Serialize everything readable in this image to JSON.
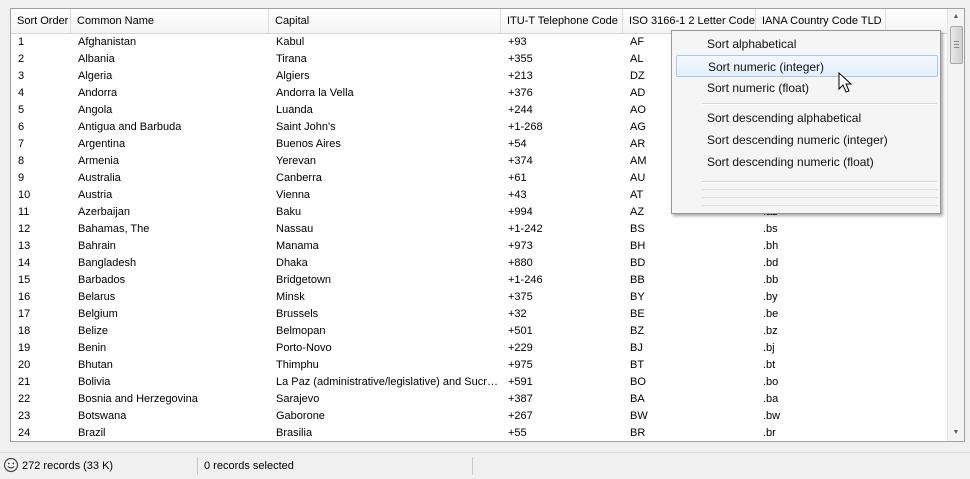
{
  "table": {
    "columns": [
      "Sort Order",
      "Common Name",
      "Capital",
      "ITU-T Telephone Code",
      "ISO 3166-1 2 Letter Code",
      "IANA Country Code TLD"
    ],
    "rows": [
      [
        "1",
        "Afghanistan",
        "Kabul",
        "+93",
        "AF",
        ""
      ],
      [
        "2",
        "Albania",
        "Tirana",
        "+355",
        "AL",
        ""
      ],
      [
        "3",
        "Algeria",
        "Algiers",
        "+213",
        "DZ",
        ""
      ],
      [
        "4",
        "Andorra",
        "Andorra la Vella",
        "+376",
        "AD",
        ""
      ],
      [
        "5",
        "Angola",
        "Luanda",
        "+244",
        "AO",
        ""
      ],
      [
        "6",
        "Antigua and Barbuda",
        "Saint John's",
        "+1-268",
        "AG",
        ""
      ],
      [
        "7",
        "Argentina",
        "Buenos Aires",
        "+54",
        "AR",
        ""
      ],
      [
        "8",
        "Armenia",
        "Yerevan",
        "+374",
        "AM",
        ""
      ],
      [
        "9",
        "Australia",
        "Canberra",
        "+61",
        "AU",
        ""
      ],
      [
        "10",
        "Austria",
        "Vienna",
        "+43",
        "AT",
        ""
      ],
      [
        "11",
        "Azerbaijan",
        "Baku",
        "+994",
        "AZ",
        ".az"
      ],
      [
        "12",
        "Bahamas, The",
        "Nassau",
        "+1-242",
        "BS",
        ".bs"
      ],
      [
        "13",
        "Bahrain",
        "Manama",
        "+973",
        "BH",
        ".bh"
      ],
      [
        "14",
        "Bangladesh",
        "Dhaka",
        "+880",
        "BD",
        ".bd"
      ],
      [
        "15",
        "Barbados",
        "Bridgetown",
        "+1-246",
        "BB",
        ".bb"
      ],
      [
        "16",
        "Belarus",
        "Minsk",
        "+375",
        "BY",
        ".by"
      ],
      [
        "17",
        "Belgium",
        "Brussels",
        "+32",
        "BE",
        ".be"
      ],
      [
        "18",
        "Belize",
        "Belmopan",
        "+501",
        "BZ",
        ".bz"
      ],
      [
        "19",
        "Benin",
        "Porto-Novo",
        "+229",
        "BJ",
        ".bj"
      ],
      [
        "20",
        "Bhutan",
        "Thimphu",
        "+975",
        "BT",
        ".bt"
      ],
      [
        "21",
        "Bolivia",
        "La Paz (administrative/legislative) and Sucre (judicial)",
        "+591",
        "BO",
        ".bo"
      ],
      [
        "22",
        "Bosnia and Herzegovina",
        "Sarajevo",
        "+387",
        "BA",
        ".ba"
      ],
      [
        "23",
        "Botswana",
        "Gaborone",
        "+267",
        "BW",
        ".bw"
      ],
      [
        "24",
        "Brazil",
        "Brasilia",
        "+55",
        "BR",
        ".br"
      ]
    ]
  },
  "context_menu": {
    "items": [
      {
        "label": "Sort alphabetical",
        "highlighted": false
      },
      {
        "label": "Sort numeric (integer)",
        "highlighted": true
      },
      {
        "label": "Sort numeric (float)",
        "highlighted": false
      },
      {
        "label": "Sort descending alphabetical",
        "highlighted": false
      },
      {
        "label": "Sort descending numeric (integer)",
        "highlighted": false
      },
      {
        "label": "Sort descending numeric (float)",
        "highlighted": false
      }
    ]
  },
  "statusbar": {
    "records": "272 records (33 K)",
    "selected": "0 records selected",
    "icon": "smiley-face-icon"
  },
  "colors": {
    "menu_highlight": "#e3eefc",
    "menu_highlight_border": "#a8c9ee",
    "grid_border": "#a0a0a0"
  }
}
